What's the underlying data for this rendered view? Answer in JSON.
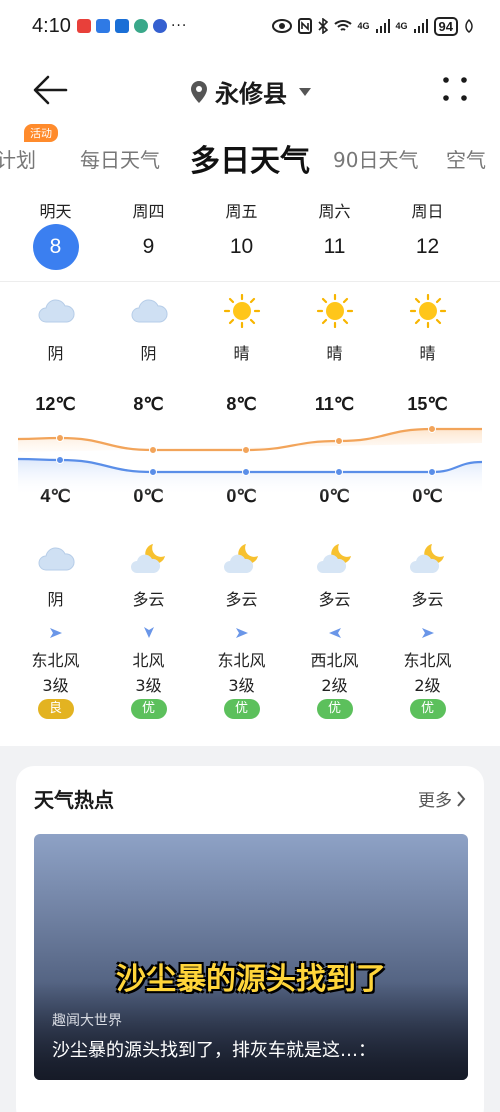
{
  "status": {
    "time": "4:10",
    "battery": "94",
    "dots": "···",
    "net1": "4G",
    "net2": "4G"
  },
  "header": {
    "location": "永修县"
  },
  "tabs": [
    {
      "label": "计划"
    },
    {
      "label": "每日天气"
    },
    {
      "label": "多日天气"
    },
    {
      "label": "90日天气"
    },
    {
      "label": "空气"
    }
  ],
  "activity_badge": "活动",
  "forecast": [
    {
      "day": "明天",
      "date": "8",
      "day_weather": "阴",
      "day_icon": "cloud-icon",
      "high": "12℃",
      "low": "4℃",
      "night_weather": "阴",
      "night_icon": "cloud-icon",
      "wind_dir": "东北风",
      "wind_level": "3级",
      "aqi": "良",
      "aqi_color": "#e3b321"
    },
    {
      "day": "周四",
      "date": "9",
      "day_weather": "阴",
      "day_icon": "cloud-icon",
      "high": "8℃",
      "low": "0℃",
      "night_weather": "多云",
      "night_icon": "moon-cloud-icon",
      "wind_dir": "北风",
      "wind_level": "3级",
      "aqi": "优",
      "aqi_color": "#5cc05c"
    },
    {
      "day": "周五",
      "date": "10",
      "day_weather": "晴",
      "day_icon": "sun-icon",
      "high": "8℃",
      "low": "0℃",
      "night_weather": "多云",
      "night_icon": "moon-cloud-icon",
      "wind_dir": "东北风",
      "wind_level": "3级",
      "aqi": "优",
      "aqi_color": "#5cc05c"
    },
    {
      "day": "周六",
      "date": "11",
      "day_weather": "晴",
      "day_icon": "sun-icon",
      "high": "11℃",
      "low": "0℃",
      "night_weather": "多云",
      "night_icon": "moon-cloud-icon",
      "wind_dir": "西北风",
      "wind_level": "2级",
      "aqi": "优",
      "aqi_color": "#5cc05c"
    },
    {
      "day": "周日",
      "date": "12",
      "day_weather": "晴",
      "day_icon": "sun-icon",
      "high": "15℃",
      "low": "0℃",
      "night_weather": "多云",
      "night_icon": "moon-cloud-icon",
      "wind_dir": "东北风",
      "wind_level": "2级",
      "aqi": "优",
      "aqi_color": "#5cc05c"
    }
  ],
  "hot": {
    "title": "天气热点",
    "more": "更多",
    "news_headline": "沙尘暴的源头找到了",
    "news_source": "趣闻大世界",
    "news_text": "沙尘暴的源头找到了，排灰车就是这…："
  },
  "colors": {
    "accent": "#3b7ff0",
    "high_line": "#f2a45a",
    "low_line": "#5a8ee8"
  }
}
